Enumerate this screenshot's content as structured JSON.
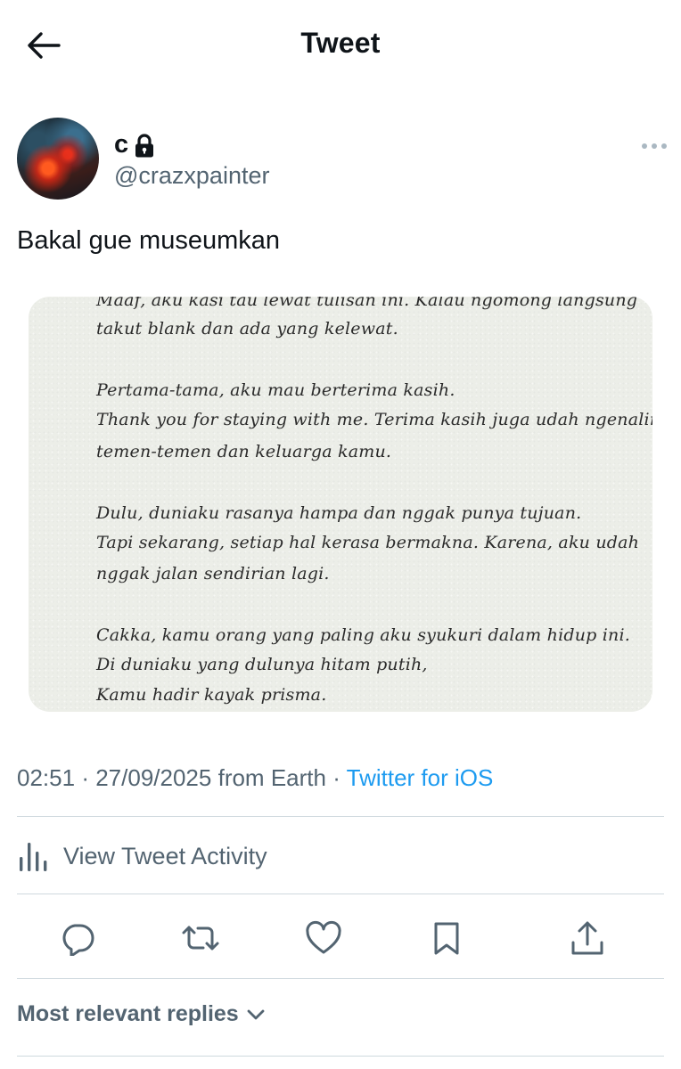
{
  "header": {
    "title": "Tweet",
    "back_icon": "arrow-left-icon"
  },
  "author": {
    "display_name": "c",
    "handle": "@crazxpainter",
    "protected_icon": "lock-icon",
    "more_icon": "more-horizontal-icon"
  },
  "tweet": {
    "text": "Bakal gue museumkan",
    "image_lines": {
      "l0": "Maaf, aku kasi tau lewat tulisan ini. Kalau ngomong langsung",
      "l1": "takut blank dan ada yang kelewat.",
      "l2": "Pertama-tama, aku mau berterima kasih.",
      "l3": "Thank you for staying with me. Terima kasih juga udah ngenalin",
      "l4": "temen-temen dan keluarga kamu.",
      "l5": "Dulu, duniaku rasanya hampa dan nggak punya tujuan.",
      "l6": "Tapi sekarang, setiap hal kerasa bermakna. Karena, aku udah",
      "l7": "nggak jalan sendirian lagi.",
      "l8": "Cakka, kamu orang yang paling aku syukuri dalam hidup ini.",
      "l9": "Di duniaku yang dulunya hitam putih,",
      "l10": "Kamu hadir kayak prisma."
    }
  },
  "meta": {
    "time": "02:51",
    "sep1": "·",
    "date": "27/09/2025",
    "location": "from Earth",
    "sep2": "·",
    "client": "Twitter for iOS"
  },
  "activity": {
    "label": "View Tweet Activity",
    "icon": "bar-chart-icon"
  },
  "actions": {
    "reply_icon": "reply-icon",
    "retweet_icon": "retweet-icon",
    "like_icon": "heart-icon",
    "bookmark_icon": "bookmark-icon",
    "share_icon": "share-icon"
  },
  "replies": {
    "sort_label": "Most relevant replies",
    "icon": "chevron-down-icon"
  },
  "colors": {
    "accent": "#1d9bf0",
    "secondary_text": "#536471",
    "divider": "#cfd9de"
  }
}
